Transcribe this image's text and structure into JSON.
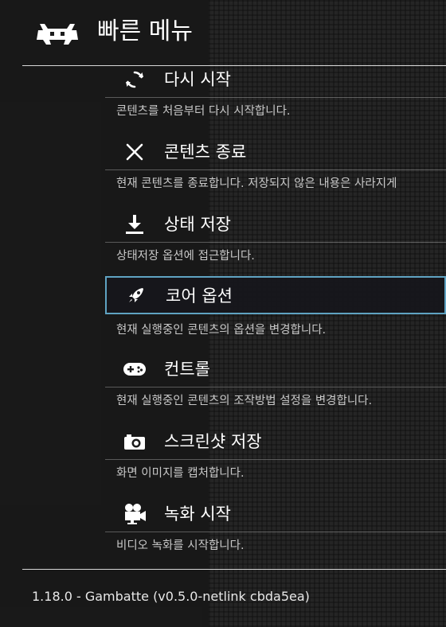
{
  "header": {
    "title": "빠른 메뉴",
    "logo_icon": "retroarch-invader-icon"
  },
  "menu": {
    "items": [
      {
        "label": "다시 시작",
        "description": "콘텐츠를 처음부터 다시 시작합니다.",
        "icon": "restart-icon",
        "selected": false
      },
      {
        "label": "콘텐츠 종료",
        "description": "현재 콘텐츠를 종료합니다. 저장되지 않은 내용은 사라지게",
        "icon": "close-icon",
        "selected": false
      },
      {
        "label": "상태 저장",
        "description": "상태저장 옵션에 접근합니다.",
        "icon": "download-icon",
        "selected": false
      },
      {
        "label": "코어 옵션",
        "description": "현재 실행중인 콘텐츠의 옵션을 변경합니다.",
        "icon": "rocket-icon",
        "selected": true
      },
      {
        "label": "컨트롤",
        "description": "현재 실행중인 콘텐츠의 조작방법 설정을 변경합니다.",
        "icon": "gamepad-icon",
        "selected": false
      },
      {
        "label": "스크린샷 저장",
        "description": "화면 이미지를 캡처합니다.",
        "icon": "camera-icon",
        "selected": false
      },
      {
        "label": "녹화 시작",
        "description": "비디오 녹화를 시작합니다.",
        "icon": "video-camera-icon",
        "selected": false
      }
    ]
  },
  "footer": {
    "core_info": "1.18.0 - Gambatte (v0.5.0-netlink cbda5ea)"
  },
  "colors": {
    "selection_border": "#5fa3c2",
    "text": "#ffffff",
    "description_text": "#c8c8c8"
  }
}
